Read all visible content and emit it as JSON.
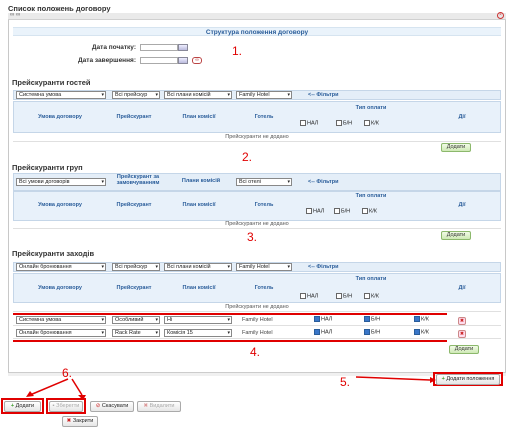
{
  "page": {
    "title": "Список положень договору",
    "topbar_info": "∞ ∞",
    "structure_title": "Структура положення договору",
    "start_date_label": "Дата початку:",
    "end_date_label": "Дата завершення:"
  },
  "guests": {
    "title": "Прейскуранти гостей",
    "filters": [
      "Системна умова",
      "Всі прейскур",
      "Всі плани комісій",
      "Family Hotel"
    ],
    "filter_link": "<-- Фільтри",
    "headers": [
      "Умова договору",
      "Прейскурант",
      "План комісії",
      "Готель",
      "Тип оплати",
      "Дії"
    ],
    "pay_types": [
      "НАЛ",
      "Б/Н",
      "К/К"
    ],
    "empty": "Прейскуранти не додано",
    "add": "Додати"
  },
  "groups": {
    "title": "Прейскуранти груп",
    "filters": [
      "Всі умови договорів",
      "Прейскурант за замовчуванням",
      "Плани комісій",
      "Всі отелі"
    ],
    "filter_link": "<-- Фільтри",
    "headers": [
      "Умова договору",
      "Прейскурант",
      "План комісії",
      "Готель",
      "Тип оплати",
      "Дії"
    ],
    "pay_types": [
      "НАЛ",
      "Б/Н",
      "К/К"
    ],
    "empty": "Прейскуранти не додано",
    "add": "Додати"
  },
  "events": {
    "title": "Прейскуранти заходів",
    "filters": [
      "Онлайн бронювання",
      "Всі прейскур",
      "Всі плани комісій",
      "Family Hotel"
    ],
    "filter_link": "<-- Фільтри",
    "headers": [
      "Умова договору",
      "Прейскурант",
      "План комісії",
      "Готель",
      "Тип оплати",
      "Дії"
    ],
    "pay_types": [
      "НАЛ",
      "Б/Н",
      "К/К"
    ],
    "empty": "Прейскуранти не додано",
    "rows": [
      {
        "condition": "Системна умова",
        "price": "Особливий",
        "plan": "Ні",
        "hotel": "Family Hotel"
      },
      {
        "condition": "Онлайн бронювання",
        "price": "Rack Rate",
        "plan": "Комісія 15",
        "hotel": "Family Hotel"
      }
    ],
    "add": "Додати"
  },
  "add_position": "Додати положення",
  "footer": {
    "add": "Додати",
    "save": "Зберегти",
    "cancel": "Скасувати",
    "delete": "Видалити",
    "close": "Закрити"
  },
  "annotations": [
    "1.",
    "2.",
    "3.",
    "4.",
    "5.",
    "6."
  ]
}
